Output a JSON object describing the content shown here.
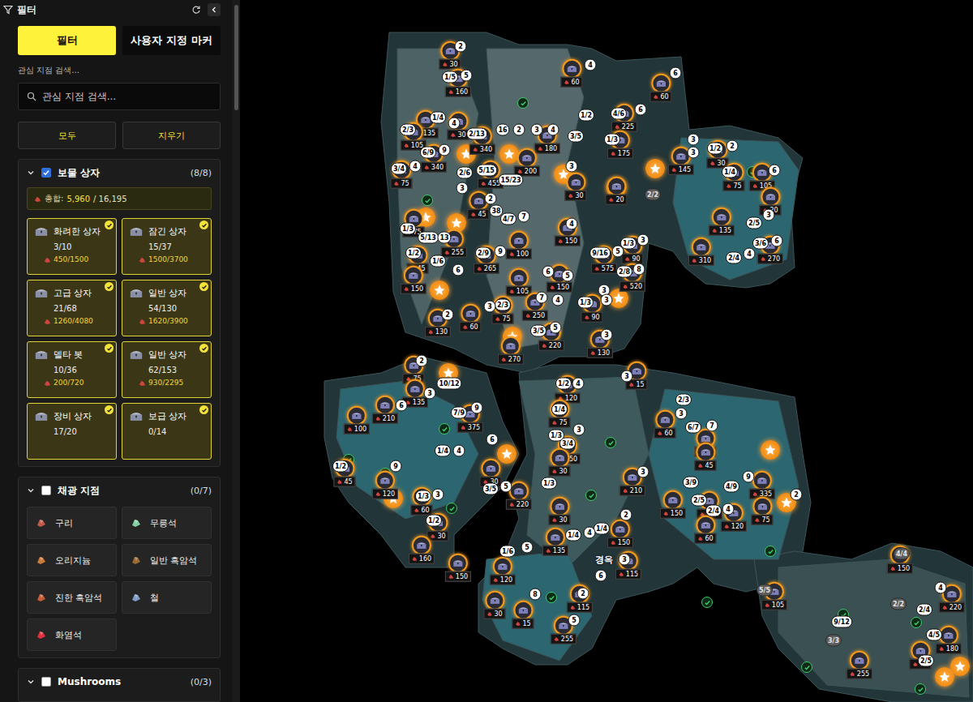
{
  "sidebar": {
    "title": "필터",
    "tabs": [
      {
        "label": "필터",
        "selected": true
      },
      {
        "label": "사용자 지정 마커",
        "selected": false
      }
    ],
    "search": {
      "label": "관심 지점 검색...",
      "placeholder": "관심 지점 검색..."
    },
    "buttons": [
      "모두",
      "지우기"
    ],
    "sections": [
      {
        "title": "보물 상자",
        "checked": true,
        "expanded": true,
        "count": "(8/8)",
        "total": {
          "label": "총합:",
          "value": "5,960",
          "max": "/ 16,195"
        },
        "cards": [
          {
            "name": "화려한 상자",
            "count": "3/10",
            "reward": "450/1500",
            "checked": true
          },
          {
            "name": "잠긴 상자",
            "count": "15/37",
            "reward": "1500/3700",
            "checked": true
          },
          {
            "name": "고급 상자",
            "count": "21/68",
            "reward": "1260/4080",
            "checked": true
          },
          {
            "name": "일반 상자",
            "count": "54/130",
            "reward": "1620/3900",
            "checked": true
          },
          {
            "name": "델타 봇",
            "count": "10/36",
            "reward": "200/720",
            "checked": true
          },
          {
            "name": "일반 상자",
            "count": "62/153",
            "reward": "930/2295",
            "checked": true
          },
          {
            "name": "장비 상자",
            "count": "17/20",
            "reward": "",
            "checked": true
          },
          {
            "name": "보급 상자",
            "count": "0/14",
            "reward": "",
            "checked": true
          }
        ]
      },
      {
        "title": "채광 지점",
        "checked": false,
        "expanded": true,
        "count": "(0/7)",
        "items": [
          {
            "name": "구리",
            "color": "#c25a4c"
          },
          {
            "name": "무릉석",
            "color": "#86cfa6"
          },
          {
            "name": "오리지늄",
            "color": "#c97a36"
          },
          {
            "name": "일반 흑암석",
            "color": "#9c6a34"
          },
          {
            "name": "진한 흑암석",
            "color": "#c45a36"
          },
          {
            "name": "철",
            "color": "#7f9cc4"
          },
          {
            "name": "화염석",
            "color": "#e0303e"
          }
        ]
      },
      {
        "title": "Mushrooms",
        "checked": false,
        "expanded": true,
        "count": "(0/3)",
        "items": []
      }
    ]
  },
  "map": {
    "labels": [
      {
        "text": "경옥"
      }
    ],
    "chests": [
      {
        "value": "30"
      },
      {
        "value": "160"
      },
      {
        "value": "60"
      },
      {
        "value": "60"
      },
      {
        "value": "135"
      },
      {
        "value": "30"
      },
      {
        "value": "105"
      },
      {
        "value": "340"
      },
      {
        "value": "180"
      },
      {
        "value": "225"
      },
      {
        "value": "175"
      },
      {
        "value": "340"
      },
      {
        "value": "455"
      },
      {
        "value": "200"
      },
      {
        "value": "75"
      },
      {
        "value": "145"
      },
      {
        "value": "30"
      },
      {
        "value": "75"
      },
      {
        "value": "105"
      },
      {
        "value": "30"
      },
      {
        "value": "20"
      },
      {
        "value": "20"
      },
      {
        "value": "45"
      },
      {
        "value": "75"
      },
      {
        "value": "150"
      },
      {
        "value": "255"
      },
      {
        "value": "45"
      },
      {
        "value": "265"
      },
      {
        "value": "100"
      },
      {
        "value": "310"
      },
      {
        "value": "270"
      },
      {
        "value": "135"
      },
      {
        "value": "90"
      },
      {
        "value": "575"
      },
      {
        "value": "520"
      },
      {
        "value": "150"
      },
      {
        "value": "150"
      },
      {
        "value": "105"
      },
      {
        "value": "75"
      },
      {
        "value": "250"
      },
      {
        "value": "90"
      },
      {
        "value": "60"
      },
      {
        "value": "130"
      },
      {
        "value": "220"
      },
      {
        "value": "270"
      },
      {
        "value": "130"
      },
      {
        "value": "75"
      },
      {
        "value": "135"
      },
      {
        "value": "15"
      },
      {
        "value": "120"
      },
      {
        "value": "100"
      },
      {
        "value": "210"
      },
      {
        "value": "375"
      },
      {
        "value": "75"
      },
      {
        "value": "60"
      },
      {
        "value": "15"
      },
      {
        "value": "45"
      },
      {
        "value": "150"
      },
      {
        "value": "30"
      },
      {
        "value": "30"
      },
      {
        "value": "45"
      },
      {
        "value": "120"
      },
      {
        "value": "210"
      },
      {
        "value": "335"
      },
      {
        "value": "220"
      },
      {
        "value": "150"
      },
      {
        "value": "105"
      },
      {
        "value": "120"
      },
      {
        "value": "75"
      },
      {
        "value": "60"
      },
      {
        "value": "30"
      },
      {
        "value": "30"
      },
      {
        "value": "60"
      },
      {
        "value": "150"
      },
      {
        "value": "160"
      },
      {
        "value": "135"
      },
      {
        "value": "115"
      },
      {
        "value": "150"
      },
      {
        "value": "120"
      },
      {
        "value": "115"
      },
      {
        "value": "30"
      },
      {
        "value": "15"
      },
      {
        "value": "255"
      },
      {
        "value": "150"
      },
      {
        "value": "220"
      },
      {
        "value": "180"
      },
      {
        "value": "60"
      },
      {
        "value": "255"
      },
      {
        "value": "105"
      }
    ],
    "badges": [
      {
        "text": "2",
        "dim": false
      },
      {
        "text": "1/5",
        "dim": false
      },
      {
        "text": "5",
        "dim": false
      },
      {
        "text": "4",
        "dim": false
      },
      {
        "text": "6",
        "dim": false
      },
      {
        "text": "1/4",
        "dim": false
      },
      {
        "text": "2/3",
        "dim": false
      },
      {
        "text": "4",
        "dim": false
      },
      {
        "text": "6/9",
        "dim": false
      },
      {
        "text": "9",
        "dim": false
      },
      {
        "text": "2/13",
        "dim": false
      },
      {
        "text": "16",
        "dim": false
      },
      {
        "text": "2",
        "dim": false
      },
      {
        "text": "3",
        "dim": false
      },
      {
        "text": "4",
        "dim": false
      },
      {
        "text": "1/2",
        "dim": false
      },
      {
        "text": "4/6",
        "dim": false
      },
      {
        "text": "6",
        "dim": false
      },
      {
        "text": "3/4",
        "dim": false
      },
      {
        "text": "4",
        "dim": false
      },
      {
        "text": "2/6",
        "dim": false
      },
      {
        "text": "5/15",
        "dim": false
      },
      {
        "text": "15/23",
        "dim": false
      },
      {
        "text": "3/5",
        "dim": false
      },
      {
        "text": "1/3",
        "dim": false
      },
      {
        "text": "3",
        "dim": false
      },
      {
        "text": "1/2",
        "dim": false
      },
      {
        "text": "2",
        "dim": false
      },
      {
        "text": "3",
        "dim": false
      },
      {
        "text": "1/4",
        "dim": false
      },
      {
        "text": "6",
        "dim": false
      },
      {
        "text": "3",
        "dim": false
      },
      {
        "text": "3",
        "dim": false
      },
      {
        "text": "2/2",
        "dim": true
      },
      {
        "text": "2",
        "dim": false
      },
      {
        "text": "38",
        "dim": false
      },
      {
        "text": "4/7",
        "dim": false
      },
      {
        "text": "7",
        "dim": false
      },
      {
        "text": "1/3",
        "dim": false
      },
      {
        "text": "4",
        "dim": false
      },
      {
        "text": "2/5",
        "dim": false
      },
      {
        "text": "3",
        "dim": false
      },
      {
        "text": "5/13",
        "dim": false
      },
      {
        "text": "13",
        "dim": false
      },
      {
        "text": "1/2",
        "dim": false
      },
      {
        "text": "2/9",
        "dim": false
      },
      {
        "text": "9",
        "dim": false
      },
      {
        "text": "9/16",
        "dim": false
      },
      {
        "text": "5",
        "dim": false
      },
      {
        "text": "1/3",
        "dim": false
      },
      {
        "text": "3",
        "dim": false
      },
      {
        "text": "3/6",
        "dim": false
      },
      {
        "text": "6",
        "dim": false
      },
      {
        "text": "2/4",
        "dim": false
      },
      {
        "text": "4",
        "dim": false
      },
      {
        "text": "1/6",
        "dim": false
      },
      {
        "text": "6",
        "dim": false
      },
      {
        "text": "2/8",
        "dim": false
      },
      {
        "text": "8",
        "dim": false
      },
      {
        "text": "6",
        "dim": false
      },
      {
        "text": "5",
        "dim": false
      },
      {
        "text": "3",
        "dim": false
      },
      {
        "text": "1/3",
        "dim": false
      },
      {
        "text": "3",
        "dim": false
      },
      {
        "text": "2/3",
        "dim": false
      },
      {
        "text": "3",
        "dim": false
      },
      {
        "text": "7",
        "dim": false
      },
      {
        "text": "4",
        "dim": false
      },
      {
        "text": "2",
        "dim": false
      },
      {
        "text": "3/5",
        "dim": false
      },
      {
        "text": "5",
        "dim": false
      },
      {
        "text": "3",
        "dim": false
      },
      {
        "text": "2",
        "dim": false
      },
      {
        "text": "3",
        "dim": false
      },
      {
        "text": "10/12",
        "dim": false
      },
      {
        "text": "6",
        "dim": false
      },
      {
        "text": "1/2",
        "dim": false
      },
      {
        "text": "4",
        "dim": false
      },
      {
        "text": "3",
        "dim": false
      },
      {
        "text": "1/4",
        "dim": false
      },
      {
        "text": "2/3",
        "dim": false
      },
      {
        "text": "7/9",
        "dim": false
      },
      {
        "text": "9",
        "dim": false
      },
      {
        "text": "1/3",
        "dim": false
      },
      {
        "text": "3",
        "dim": false
      },
      {
        "text": "3",
        "dim": false
      },
      {
        "text": "6/7",
        "dim": false
      },
      {
        "text": "7",
        "dim": false
      },
      {
        "text": "3/4",
        "dim": false
      },
      {
        "text": "6",
        "dim": false
      },
      {
        "text": "1/4",
        "dim": false
      },
      {
        "text": "4",
        "dim": false
      },
      {
        "text": "1/2",
        "dim": false
      },
      {
        "text": "9",
        "dim": false
      },
      {
        "text": "3/5",
        "dim": false
      },
      {
        "text": "5",
        "dim": false
      },
      {
        "text": "1/3",
        "dim": false
      },
      {
        "text": "3",
        "dim": false
      },
      {
        "text": "3/9",
        "dim": false
      },
      {
        "text": "4/9",
        "dim": false
      },
      {
        "text": "9",
        "dim": false
      },
      {
        "text": "2",
        "dim": false
      },
      {
        "text": "2/5",
        "dim": false
      },
      {
        "text": "1/3",
        "dim": false
      },
      {
        "text": "3",
        "dim": false
      },
      {
        "text": "2/4",
        "dim": false
      },
      {
        "text": "4",
        "dim": false
      },
      {
        "text": "1/2",
        "dim": false
      },
      {
        "text": "2",
        "dim": false
      },
      {
        "text": "1/4",
        "dim": false
      },
      {
        "text": "1/4",
        "dim": false
      },
      {
        "text": "4",
        "dim": false
      },
      {
        "text": "1/6",
        "dim": false
      },
      {
        "text": "5",
        "dim": false
      },
      {
        "text": "3",
        "dim": false
      },
      {
        "text": "6",
        "dim": false
      },
      {
        "text": "2",
        "dim": false
      },
      {
        "text": "8",
        "dim": false
      },
      {
        "text": "5",
        "dim": false
      },
      {
        "text": "4/4",
        "dim": true
      },
      {
        "text": "5/5",
        "dim": true
      },
      {
        "text": "9/12",
        "dim": false
      },
      {
        "text": "2/4",
        "dim": false
      },
      {
        "text": "4",
        "dim": false
      },
      {
        "text": "4/5",
        "dim": false
      },
      {
        "text": "2/5",
        "dim": false
      },
      {
        "text": "3/3",
        "dim": true
      },
      {
        "text": "2/2",
        "dim": true
      }
    ],
    "markers": [
      {
        "kind": "star"
      },
      {
        "kind": "star"
      },
      {
        "kind": "star"
      },
      {
        "kind": "star"
      },
      {
        "kind": "star"
      },
      {
        "kind": "star"
      },
      {
        "kind": "star"
      },
      {
        "kind": "star"
      },
      {
        "kind": "star"
      },
      {
        "kind": "star"
      },
      {
        "kind": "star"
      },
      {
        "kind": "star"
      },
      {
        "kind": "star"
      },
      {
        "kind": "star"
      },
      {
        "kind": "star"
      },
      {
        "kind": "star"
      },
      {
        "kind": "star"
      },
      {
        "kind": "check"
      },
      {
        "kind": "check"
      },
      {
        "kind": "check"
      },
      {
        "kind": "check"
      },
      {
        "kind": "check"
      },
      {
        "kind": "check"
      },
      {
        "kind": "check"
      },
      {
        "kind": "check"
      },
      {
        "kind": "check"
      },
      {
        "kind": "check"
      },
      {
        "kind": "check"
      },
      {
        "kind": "check"
      },
      {
        "kind": "check"
      },
      {
        "kind": "check"
      },
      {
        "kind": "check"
      },
      {
        "kind": "check"
      }
    ]
  }
}
